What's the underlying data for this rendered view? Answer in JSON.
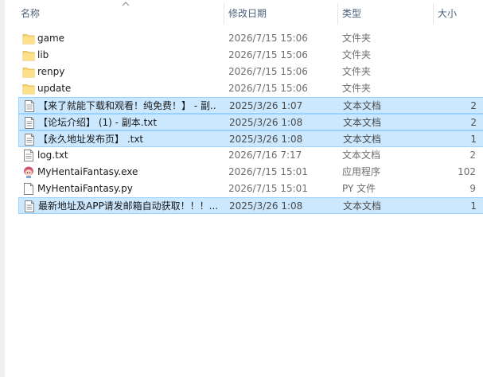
{
  "columns": {
    "name": "名称",
    "date": "修改日期",
    "type": "类型",
    "size": "大小"
  },
  "files": [
    {
      "name": "game",
      "date": "2026/7/15 15:06",
      "type": "文件夹",
      "size": "",
      "icon": "folder-icon",
      "selected": false
    },
    {
      "name": "lib",
      "date": "2026/7/15 15:06",
      "type": "文件夹",
      "size": "",
      "icon": "folder-icon",
      "selected": false
    },
    {
      "name": "renpy",
      "date": "2026/7/15 15:06",
      "type": "文件夹",
      "size": "",
      "icon": "folder-icon",
      "selected": false
    },
    {
      "name": "update",
      "date": "2026/7/15 15:06",
      "type": "文件夹",
      "size": "",
      "icon": "folder-icon",
      "selected": false
    },
    {
      "name": "【来了就能下载和观看！纯免费！】 - 副...",
      "date": "2025/3/26 1:07",
      "type": "文本文档",
      "size": "2",
      "icon": "text-document-icon",
      "selected": true
    },
    {
      "name": "【论坛介绍】 (1) - 副本.txt",
      "date": "2025/3/26 1:08",
      "type": "文本文档",
      "size": "2",
      "icon": "text-document-icon",
      "selected": true
    },
    {
      "name": "【永久地址发布页】 .txt",
      "date": "2025/3/26 1:08",
      "type": "文本文档",
      "size": "1",
      "icon": "text-document-icon",
      "selected": true
    },
    {
      "name": "log.txt",
      "date": "2026/7/16 7:17",
      "type": "文本文档",
      "size": "2",
      "icon": "text-document-icon",
      "selected": false
    },
    {
      "name": "MyHentaiFantasy.exe",
      "date": "2026/7/15 15:01",
      "type": "应用程序",
      "size": "102",
      "icon": "app-exe-icon",
      "selected": false
    },
    {
      "name": "MyHentaiFantasy.py",
      "date": "2026/7/15 15:01",
      "type": "PY 文件",
      "size": "9",
      "icon": "blank-file-icon",
      "selected": false
    },
    {
      "name": "最新地址及APP请发邮箱自动获取！！！...",
      "date": "2025/3/26 1:08",
      "type": "文本文档",
      "size": "1",
      "icon": "text-document-icon",
      "selected": true
    }
  ]
}
